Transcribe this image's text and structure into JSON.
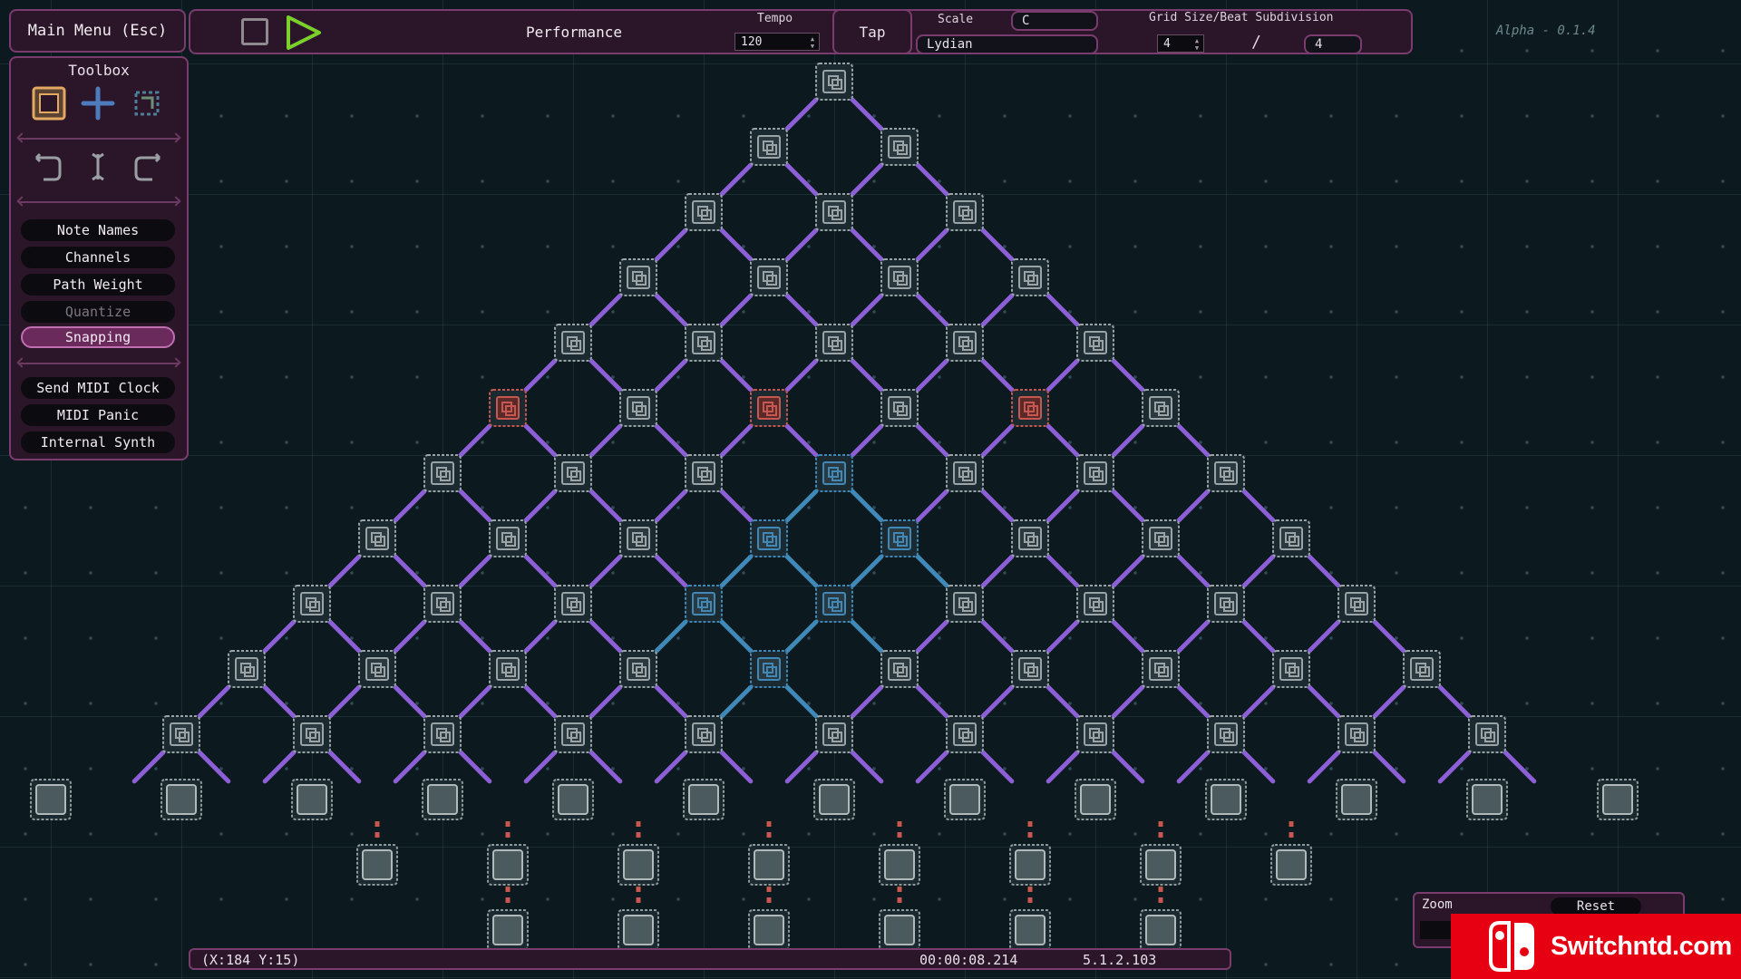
{
  "app": {
    "main_menu_label": "Main Menu (Esc)",
    "mode_title": "Performance",
    "version": "Alpha - 0.1.4"
  },
  "transport": {
    "stop_icon": "stop-icon",
    "play_icon": "play-icon",
    "play_color": "#7bd12a"
  },
  "tempo": {
    "label": "Tempo",
    "value": "120",
    "tap_label": "Tap"
  },
  "scale": {
    "label": "Scale",
    "root": "C",
    "mode": "Lydian"
  },
  "grid": {
    "label": "Grid Size/Beat Subdivision",
    "size": "4",
    "separator": "/",
    "subdivision": "4"
  },
  "toolbox": {
    "title": "Toolbox",
    "tools": [
      "place-tile-icon",
      "move-icon",
      "path-tool-icon"
    ],
    "edit_tools": [
      "rotate-left-icon",
      "flip-icon",
      "rotate-right-icon"
    ],
    "toggles": [
      {
        "label": "Note Names",
        "state": "normal"
      },
      {
        "label": "Channels",
        "state": "normal"
      },
      {
        "label": "Path Weight",
        "state": "normal"
      },
      {
        "label": "Quantize",
        "state": "disabled"
      },
      {
        "label": "Snapping",
        "state": "active"
      }
    ],
    "midi": [
      "Send MIDI Clock",
      "MIDI Panic",
      "Internal Synth"
    ]
  },
  "status": {
    "coords": "(X:184 Y:15)",
    "time": "00:00:08.214",
    "position": "5.1.2.103"
  },
  "zoom": {
    "label": "Zoom",
    "reset_label": "Reset"
  },
  "watermark": {
    "text": "Switchntd.com"
  },
  "colors": {
    "accent": "#7a3c6e",
    "node_default": "#9aa4a6",
    "node_red": "#c7574f",
    "node_blue": "#3f88b8",
    "link": "#8d5fd6"
  }
}
